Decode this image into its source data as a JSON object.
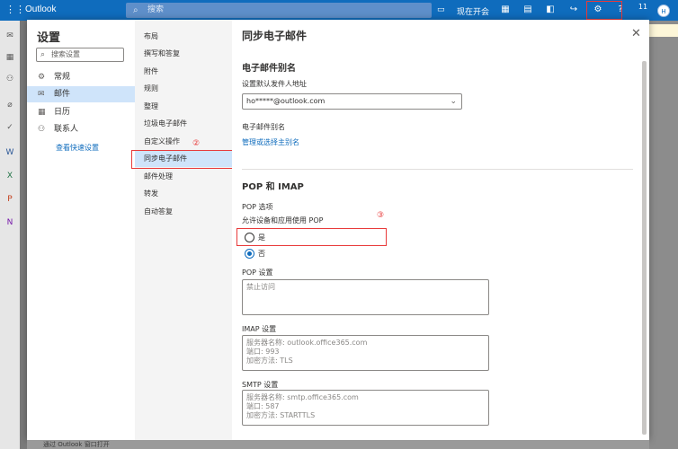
{
  "app": {
    "brand": "Outlook",
    "grid_icon": "app-launcher-icon"
  },
  "search": {
    "placeholder": "搜索"
  },
  "topbar": {
    "meet_now": "现在开会",
    "help": "?",
    "badge": "11",
    "avatar_initial": "H"
  },
  "annotations": {
    "mark1": "①",
    "mark2": "②",
    "mark3": "③"
  },
  "settings": {
    "title": "设置",
    "search_placeholder": "搜索设置",
    "categories": [
      {
        "label": "常规",
        "icon": "gear-icon"
      },
      {
        "label": "邮件",
        "icon": "mail-icon"
      },
      {
        "label": "日历",
        "icon": "calendar-icon"
      },
      {
        "label": "联系人",
        "icon": "people-icon"
      }
    ],
    "quick_settings_link": "查看快速设置",
    "mail_items": [
      "布局",
      "撰写和答复",
      "附件",
      "规则",
      "整理",
      "垃圾电子邮件",
      "自定义操作",
      "同步电子邮件",
      "邮件处理",
      "转发",
      "自动答复"
    ]
  },
  "content": {
    "title": "同步电子邮件",
    "alias_section": "电子邮件别名",
    "default_from_label": "设置默认发件人地址",
    "default_from_value": "ho*****@outlook.com",
    "alias_label": "电子邮件别名",
    "alias_link": "管理或选择主别名",
    "pop_imap_section": "POP 和 IMAP",
    "pop_options": "POP 选项",
    "allow_pop": "允许设备和应用使用 POP",
    "yes": "是",
    "no": "否",
    "pop_settings": "POP 设置",
    "pop_value": "禁止访问",
    "imap_settings": "IMAP 设置",
    "imap_lines": [
      "服务器名称: outlook.office365.com",
      "端口: 993",
      "加密方法: TLS"
    ],
    "smtp_settings": "SMTP 设置",
    "smtp_lines": [
      "服务器名称: smtp.office365.com",
      "端口: 587",
      "加密方法: STARTTLS"
    ]
  },
  "bottom": {
    "text": "通过 Outlook 窗口打开"
  }
}
